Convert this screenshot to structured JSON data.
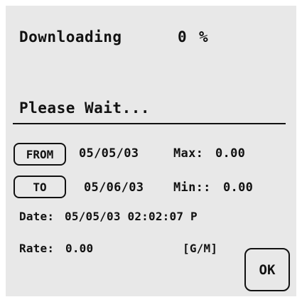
{
  "status": {
    "downloading_label": "Downloading",
    "progress_value": "0",
    "progress_unit": "%",
    "wait_message": "Please Wait..."
  },
  "range": {
    "from_button": "FROM",
    "from_date": "05/05/03",
    "to_button": "TO",
    "to_date": "05/06/03",
    "max_label": "Max:",
    "max_value": "0.00",
    "min_label": "Min::",
    "min_value": "0.00"
  },
  "current": {
    "date_label": "Date:",
    "date_value": "05/05/03 02:02:07 P",
    "rate_label": "Rate:",
    "rate_value": "0.00",
    "rate_unit": "[G/M]"
  },
  "actions": {
    "ok_label": "OK"
  }
}
